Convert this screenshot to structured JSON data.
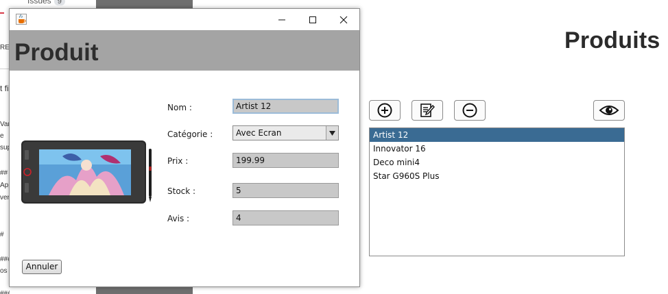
{
  "background": {
    "issues_label": "Issues",
    "issues_count": "9",
    "left_fragments": [
      "RE",
      "t fi",
      "Van",
      "e",
      "sup",
      "##",
      "App",
      "ven",
      "#",
      "###",
      "os",
      "###"
    ]
  },
  "produits": {
    "title": "Produits",
    "toolbar": {
      "add_icon": "plus-circle-icon",
      "edit_icon": "edit-document-icon",
      "remove_icon": "minus-circle-icon",
      "view_icon": "eye-icon"
    },
    "items": [
      {
        "label": "Artist 12",
        "selected": true
      },
      {
        "label": "Innovator 16",
        "selected": false
      },
      {
        "label": "Deco mini4",
        "selected": false
      },
      {
        "label": "Star G960S Plus",
        "selected": false
      }
    ]
  },
  "dialog": {
    "app_icon": "java-cup-icon",
    "header_title": "Produit",
    "form": {
      "name_label": "Nom :",
      "name_value": "Artist 12",
      "category_label": "Catégorie :",
      "category_value": "Avec Ecran",
      "price_label": "Prix :",
      "price_value": "199.99",
      "stock_label": "Stock :",
      "stock_value": "5",
      "rating_label": "Avis :",
      "rating_value": "4"
    },
    "cancel_label": "Annuler"
  },
  "colors": {
    "header_band": "#a4a4a4",
    "selection": "#3a6b93",
    "field_bg": "#c8c8c8"
  }
}
